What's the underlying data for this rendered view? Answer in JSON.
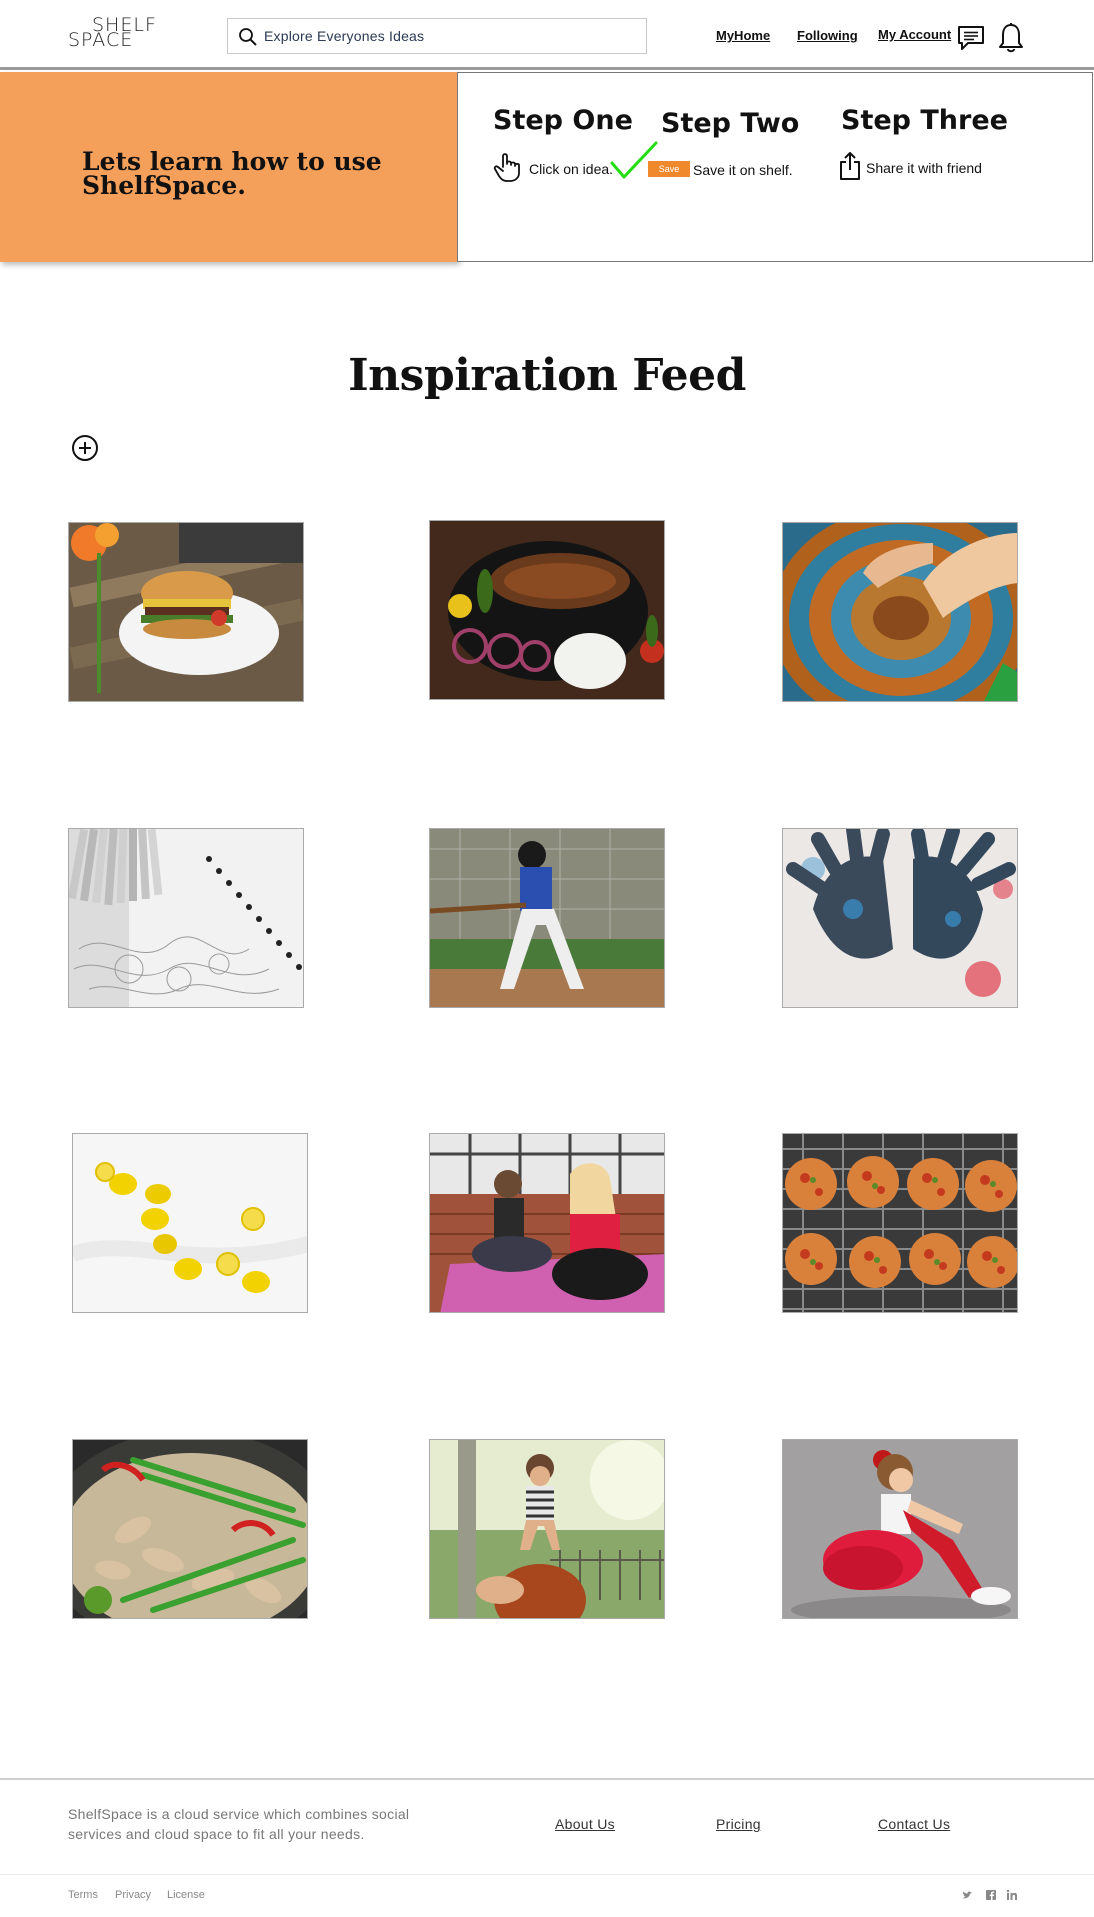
{
  "header": {
    "logo_line1": "SHELF",
    "logo_line2": "SPACE",
    "search_placeholder": "Explore Everyones Ideas",
    "nav": {
      "myhome": "MyHome",
      "following": "Following",
      "my_account": "My Account"
    },
    "icons": [
      "search-icon",
      "messages-icon",
      "bell-icon"
    ]
  },
  "banner": {
    "title": "Lets learn how to use ShelfSpace.",
    "steps": [
      {
        "title": "Step One",
        "text": "Click on idea.",
        "icon": "hand-pointer-icon"
      },
      {
        "title": "Step Two",
        "text": "Save it on shelf.",
        "chip": "Save",
        "icon": "checkmark-icon"
      },
      {
        "title": "Step Three",
        "text": "Share it with friend",
        "icon": "share-icon"
      }
    ],
    "colors": {
      "panel": "#f5a05a",
      "chip": "#f0882c",
      "check": "#22dd11"
    }
  },
  "feed": {
    "title": "Inspiration Feed",
    "add_icon": "add-circle-icon",
    "items": [
      {
        "name": "burger"
      },
      {
        "name": "grilled-meat"
      },
      {
        "name": "pottery"
      },
      {
        "name": "coloring-pencils"
      },
      {
        "name": "baseball"
      },
      {
        "name": "painted-hands"
      },
      {
        "name": "lemons"
      },
      {
        "name": "yoga"
      },
      {
        "name": "pizzas"
      },
      {
        "name": "noodle-soup"
      },
      {
        "name": "mother-child"
      },
      {
        "name": "ballerina"
      }
    ]
  },
  "footer": {
    "description": "ShelfSpace is a cloud service which combines social services and cloud space to fit all your needs.",
    "links": {
      "about": "About Us",
      "pricing": "Pricing",
      "contact": "Contact Us"
    },
    "legal": {
      "terms": "Terms",
      "privacy": "Privacy",
      "license": "License"
    },
    "social": [
      "twitter-icon",
      "facebook-icon",
      "linkedin-icon"
    ]
  }
}
